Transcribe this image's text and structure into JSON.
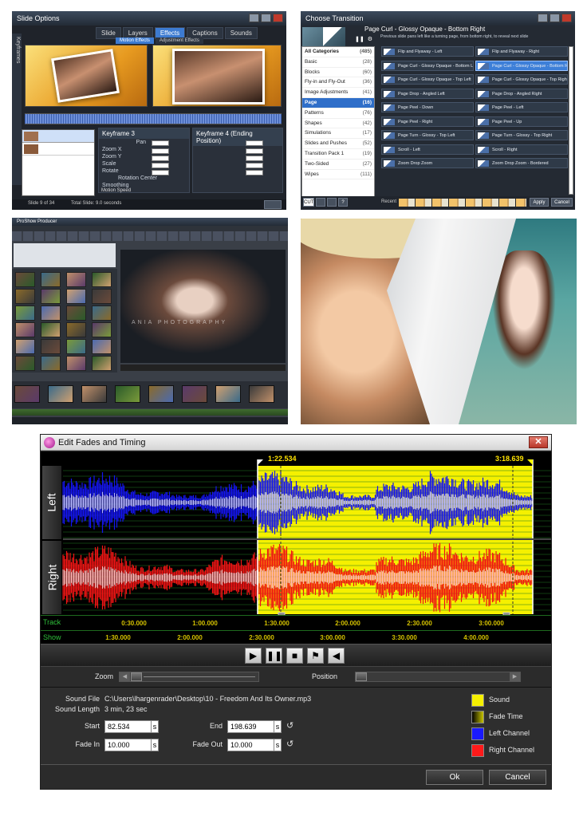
{
  "panel1": {
    "title": "Slide Options",
    "tabs": [
      "Slide",
      "Layers",
      "Effects",
      "Captions",
      "Sounds"
    ],
    "active_tab": "Effects",
    "subtabs": [
      "Motion Effects",
      "Adjustment Effects"
    ],
    "sidebar_label": "Keyframes",
    "layers_label": "Layers",
    "keyframe_start": "Keyframe 3",
    "keyframe_end": "Keyframe 4 (Ending Position)",
    "fields": [
      "Pan",
      "Zoom X",
      "Zoom Y",
      "Scale",
      "Rotate",
      "Rotation Center",
      "Smoothing"
    ],
    "motion_speed_label": "Motion Speed",
    "bottom_status": "Slide 9 of 34",
    "bottom_hint": "Total Slide: 9.0 seconds"
  },
  "panel2": {
    "title": "Choose Transition",
    "selected_name": "Page Curl - Glossy Opaque - Bottom Right",
    "selected_desc": "Previous slide pans left like a turning page, from bottom right, to reveal next slide",
    "categories": [
      {
        "name": "All Categories",
        "count": "(485)"
      },
      {
        "name": "Basic",
        "count": "(28)"
      },
      {
        "name": "Blocks",
        "count": "(60)"
      },
      {
        "name": "Fly-in and Fly-Out",
        "count": "(36)"
      },
      {
        "name": "Image Adjustments",
        "count": "(41)"
      },
      {
        "name": "Page",
        "count": "(16)"
      },
      {
        "name": "Patterns",
        "count": "(76)"
      },
      {
        "name": "Shapes",
        "count": "(42)"
      },
      {
        "name": "Simulations",
        "count": "(17)"
      },
      {
        "name": "Slides and Pushes",
        "count": "(52)"
      },
      {
        "name": "Transition Pack 1",
        "count": "(19)"
      },
      {
        "name": "Two-Sided",
        "count": "(27)"
      },
      {
        "name": "Wipes",
        "count": "(111)"
      }
    ],
    "transitions": [
      "Flip and Flyaway - Left",
      "Flip and Flyaway - Right",
      "Page Curl - Glossy Opaque - Bottom Left",
      "Page Curl - Glossy Opaque - Bottom Right",
      "Page Curl - Glossy Opaque - Top Left",
      "Page Curl - Glossy Opaque - Top Right",
      "Page Drop - Angled Left",
      "Page Drop - Angled Right",
      "Page Peel - Down",
      "Page Peel - Left",
      "Page Peel - Right",
      "Page Peel - Up",
      "Page Turn - Glossy - Top Left",
      "Page Turn - Glossy - Top Right",
      "Scroll - Left",
      "Scroll - Right",
      "Zoom Drop Zoom",
      "Zoom Drop Zoom - Bordered"
    ],
    "cut_label": "CUT",
    "recent_label": "Recent",
    "apply_label": "Apply",
    "cancel_label": "Cancel"
  },
  "panel3": {
    "title": "ProShow Producer",
    "watermark": "ANIA PHOTOGRAPHY"
  },
  "dialog": {
    "title": "Edit Fades and Timing",
    "left_label": "Left",
    "right_label": "Right",
    "marker_start": "1:22.534",
    "marker_end": "3:18.639",
    "track_label": "Track",
    "show_label": "Show",
    "track_ticks": [
      "0:30.000",
      "1:00.000",
      "1:30.000",
      "2:00.000",
      "2:30.000",
      "3:00.000"
    ],
    "show_ticks": [
      "1:30.000",
      "2:00.000",
      "2:30.000",
      "3:00.000",
      "3:30.000",
      "4:00.000"
    ],
    "zoom_label": "Zoom",
    "position_label": "Position",
    "sound_file_label": "Sound File",
    "sound_file_value": "C:\\Users\\lhargenrader\\Desktop\\10 - Freedom And Its Owner.mp3",
    "sound_length_label": "Sound Length",
    "sound_length_value": "3 min, 23 sec",
    "start_label": "Start",
    "start_value": "82.534",
    "end_label": "End",
    "end_value": "198.639",
    "fade_in_label": "Fade In",
    "fade_in_value": "10.000",
    "fade_out_label": "Fade Out",
    "fade_out_value": "10.000",
    "unit": "s",
    "legend": [
      {
        "label": "Sound",
        "color": "#f5f000"
      },
      {
        "label": "Fade Time",
        "color": "#c8c400"
      },
      {
        "label": "Left Channel",
        "color": "#1a1aff"
      },
      {
        "label": "Right Channel",
        "color": "#ff1a1a"
      }
    ],
    "ok_label": "Ok",
    "cancel_label": "Cancel"
  }
}
